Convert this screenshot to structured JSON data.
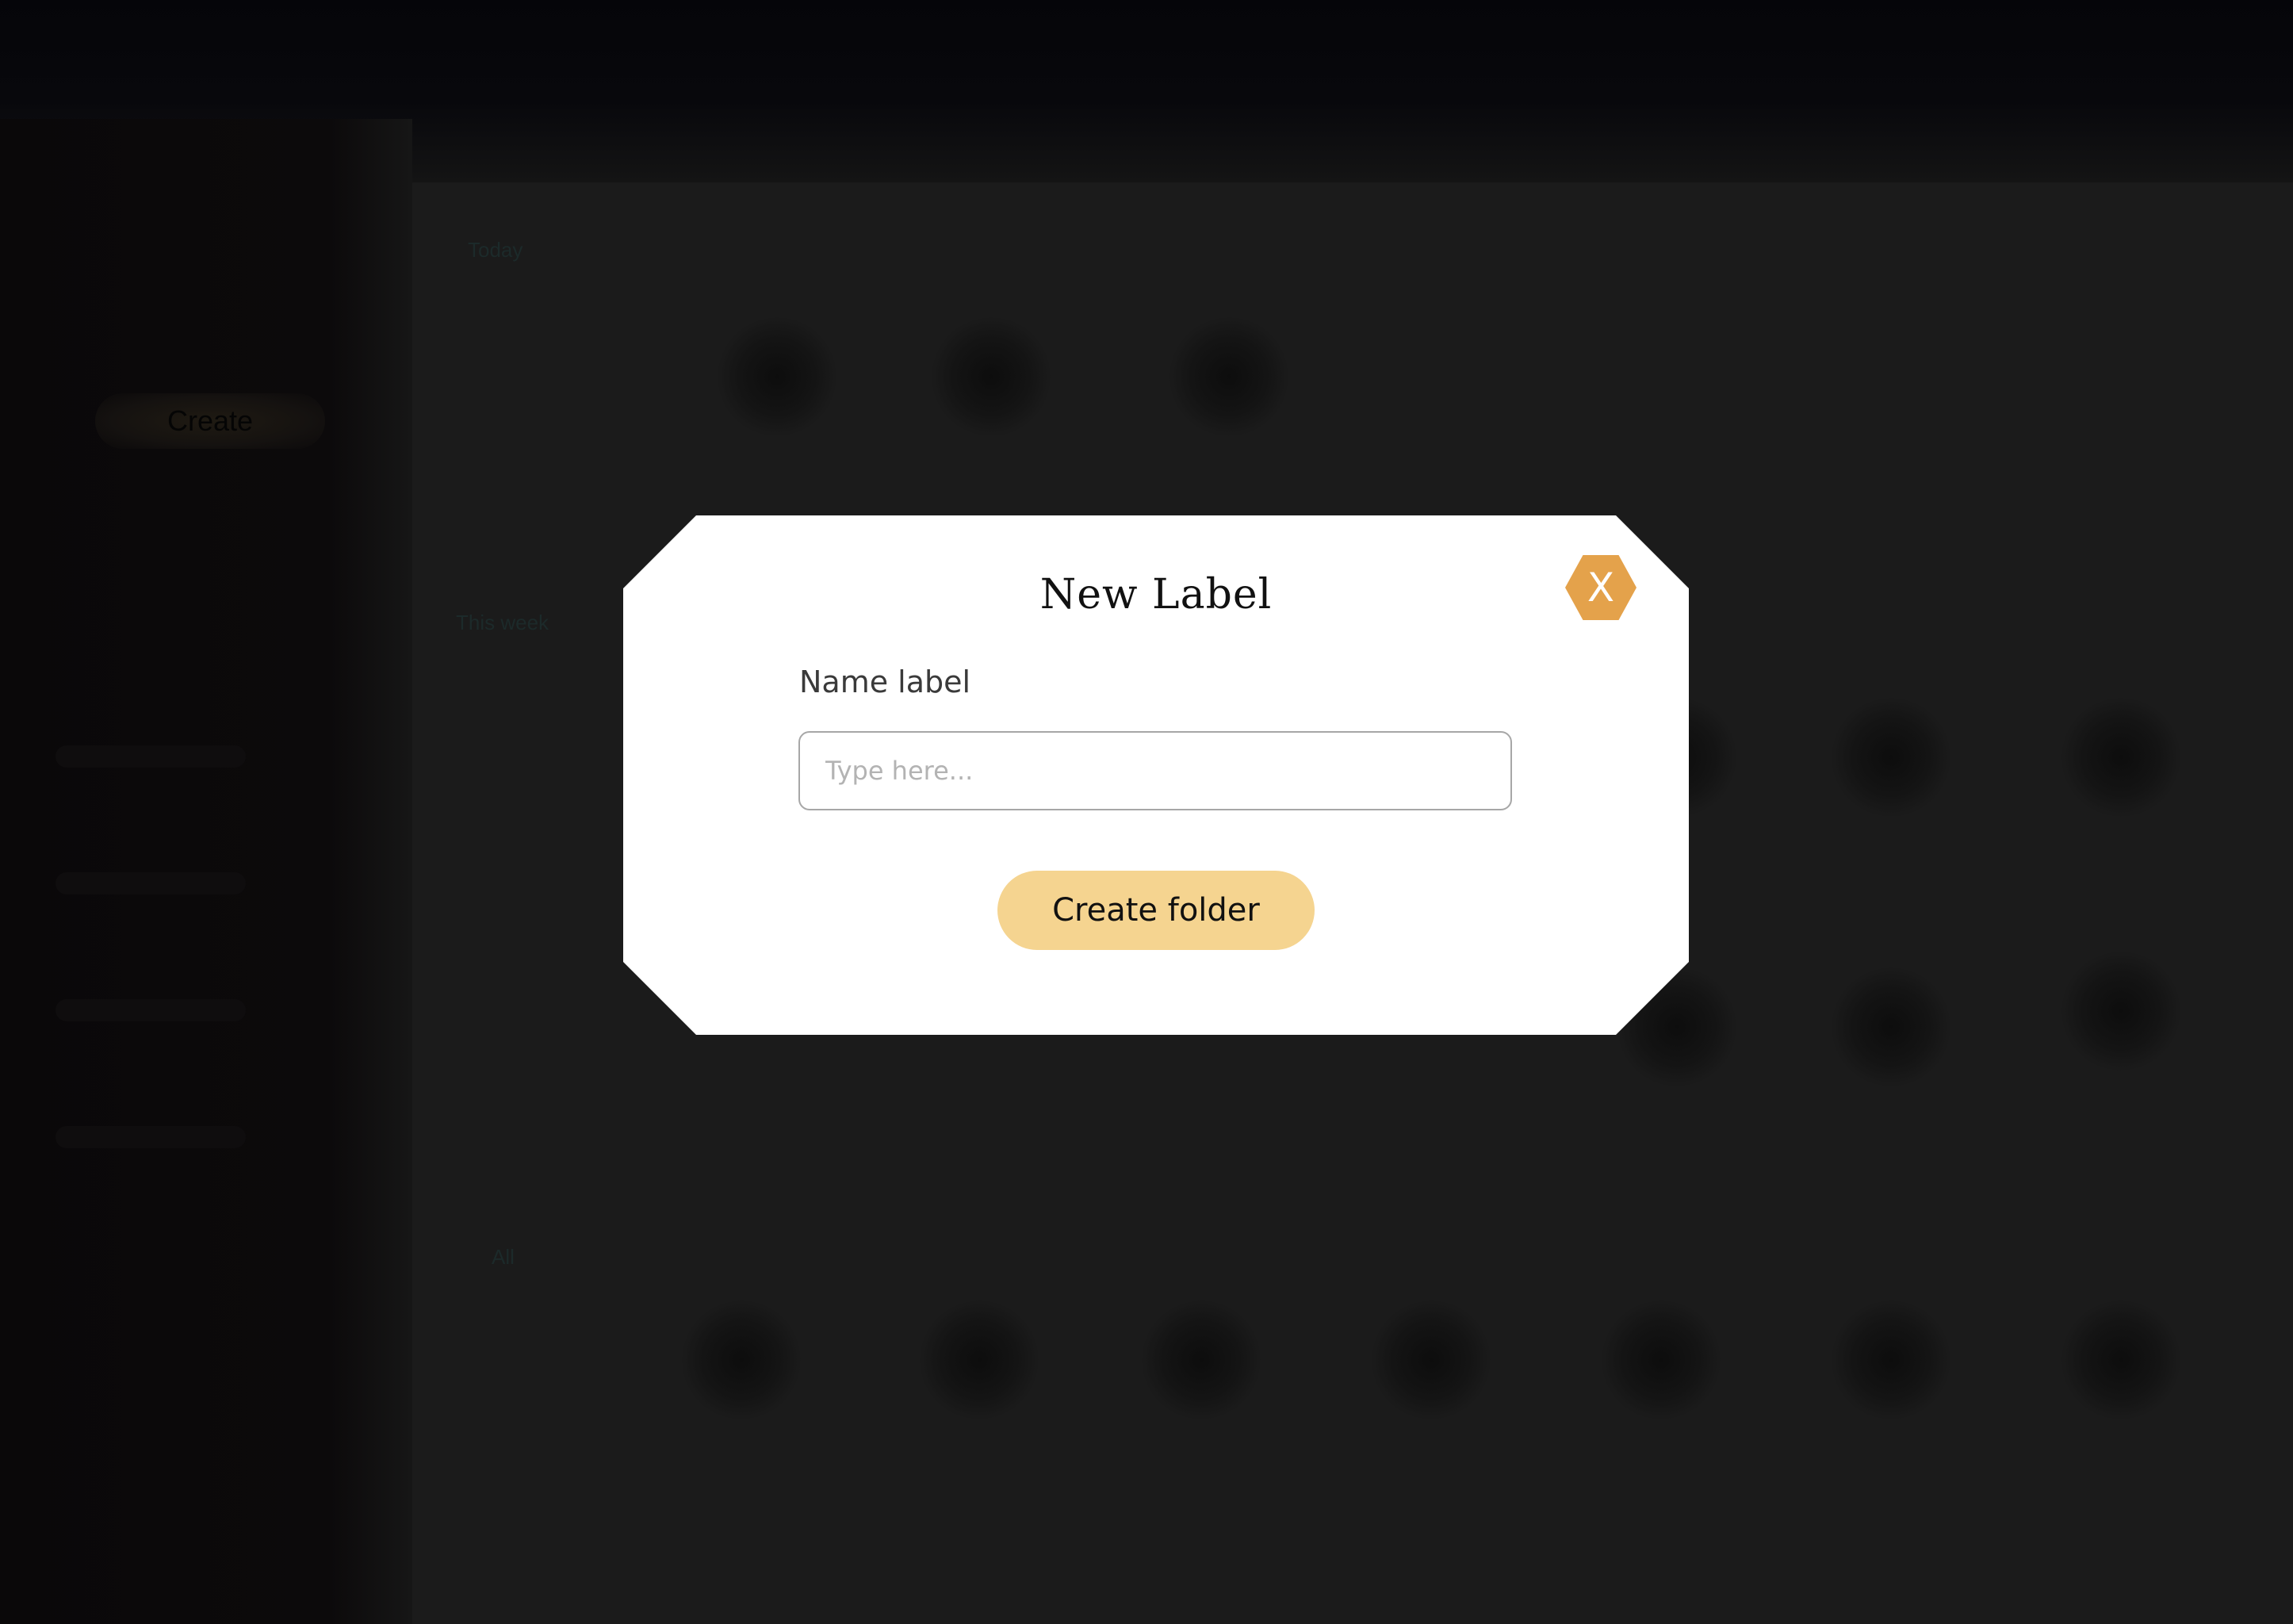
{
  "background": {
    "create_button_label": "Create",
    "sections": [
      "Today",
      "This week",
      "All"
    ]
  },
  "modal": {
    "title": "New Label",
    "close_label": "X",
    "field_label": "Name label",
    "input_placeholder": "Type here...",
    "input_value": "",
    "submit_label": "Create folder"
  },
  "colors": {
    "accent": "#e4a24b",
    "button": "#f5d490",
    "overlay": "#1b1b1b"
  }
}
